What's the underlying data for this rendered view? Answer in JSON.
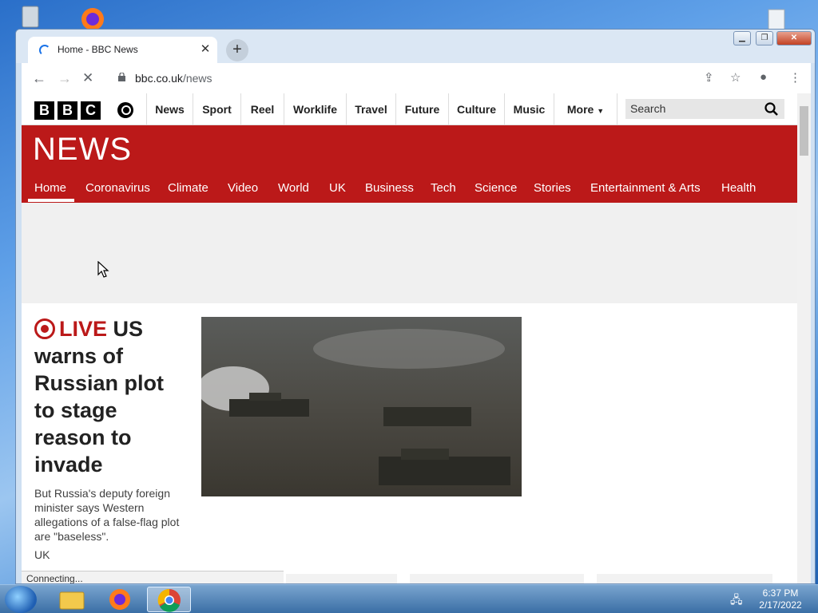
{
  "browser": {
    "tab_title": "Home - BBC News",
    "url_host": "bbc.co.uk",
    "url_path": "/news",
    "status_text": "Connecting..."
  },
  "bbc": {
    "logo_letters": [
      "B",
      "B",
      "C"
    ],
    "topnav": [
      "News",
      "Sport",
      "Reel",
      "Worklife",
      "Travel",
      "Future",
      "Culture",
      "Music"
    ],
    "more_label": "More",
    "search_placeholder": "Search",
    "brand": "NEWS",
    "sections": [
      "Home",
      "Coronavirus",
      "Climate",
      "Video",
      "World",
      "UK",
      "Business",
      "Tech",
      "Science",
      "Stories",
      "Entertainment & Arts",
      "Health"
    ],
    "active_section": "Home"
  },
  "story": {
    "live_label": "LIVE",
    "headline": "US warns of Russian plot to stage reason to invade",
    "summary": "But Russia's deputy foreign minister says Western allegations of a false-flag plot are \"baseless\".",
    "tag": "UK"
  },
  "taskbar": {
    "time": "6:37 PM",
    "date": "2/17/2022"
  },
  "colors": {
    "bbc_red": "#bb1919",
    "chrome_blue": "#1a73e8"
  }
}
